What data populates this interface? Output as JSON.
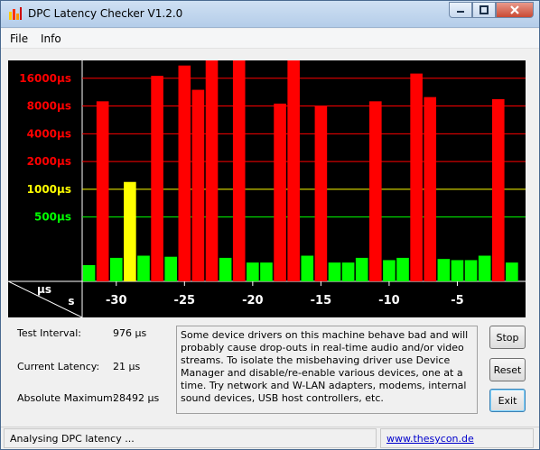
{
  "window": {
    "title": "DPC Latency Checker V1.2.0"
  },
  "menu": {
    "items": [
      "File",
      "Info"
    ]
  },
  "chart_data": {
    "type": "bar",
    "y_tick_labels": [
      {
        "label": "16000µs",
        "color": "#ff0000"
      },
      {
        "label": "8000µs",
        "color": "#ff0000"
      },
      {
        "label": "4000µs",
        "color": "#ff0000"
      },
      {
        "label": "2000µs",
        "color": "#ff0000"
      },
      {
        "label": "1000µs",
        "color": "#ffff00"
      },
      {
        "label": "500µs",
        "color": "#00ff00"
      }
    ],
    "y_tick_values": [
      16000,
      8000,
      4000,
      2000,
      1000,
      500
    ],
    "y_scale": "log2",
    "ylim": [
      100,
      25000
    ],
    "x_tick_labels": [
      "-30",
      "-25",
      "-20",
      "-15",
      "-10",
      "-5"
    ],
    "x_tick_values": [
      -30,
      -25,
      -20,
      -15,
      -10,
      -5
    ],
    "xlim": [
      -32.5,
      0
    ],
    "y_unit_label": "µs",
    "x_unit_label": "s",
    "bar_x": [
      -32,
      -31,
      -30,
      -29,
      -28,
      -27,
      -26,
      -25,
      -24,
      -23,
      -22,
      -21,
      -20,
      -19,
      -18,
      -17,
      -16,
      -15,
      -14,
      -13,
      -12,
      -11,
      -10,
      -9,
      -8,
      -7,
      -6,
      -5,
      -4,
      -3,
      -2,
      -1
    ],
    "values": [
      150,
      9000,
      180,
      1200,
      190,
      17000,
      185,
      22000,
      12000,
      25000,
      180,
      25000,
      160,
      160,
      8500,
      25000,
      190,
      8000,
      160,
      160,
      180,
      9000,
      170,
      180,
      18000,
      10000,
      175,
      170,
      170,
      190,
      9500,
      160
    ],
    "colors": {
      "red": "#ff0000",
      "yellow": "#ffff00",
      "green": "#00ff00"
    },
    "thresholds": {
      "green_max": 500,
      "yellow_max": 1000
    },
    "grid": true
  },
  "stats": {
    "test_interval_label": "Test Interval:",
    "test_interval_value": "976 µs",
    "current_latency_label": "Current Latency:",
    "current_latency_value": "21 µs",
    "absolute_maximum_label": "Absolute Maximum:",
    "absolute_maximum_value": "28492 µs"
  },
  "message": "Some device drivers on this machine behave bad and will probably cause drop-outs in real-time audio and/or video streams. To isolate the misbehaving driver use Device Manager and disable/re-enable various devices, one at a time. Try network and W-LAN adapters, modems, internal sound devices, USB host controllers, etc.",
  "buttons": {
    "stop": "Stop",
    "reset": "Reset",
    "exit": "Exit"
  },
  "status": {
    "text": "Analysing DPC latency ...",
    "link": "www.thesycon.de"
  }
}
